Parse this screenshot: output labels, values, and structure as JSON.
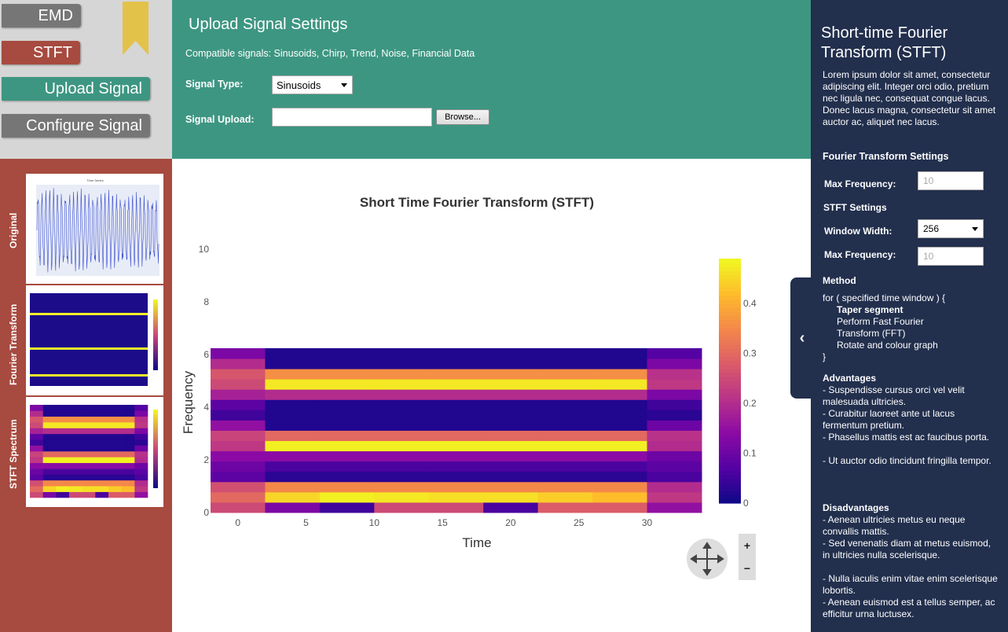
{
  "nav": {
    "emd_label": "EMD",
    "stft_label": "STFT",
    "upload_label": "Upload Signal",
    "configure_label": "Configure Signal"
  },
  "upload": {
    "title": "Upload Signal Settings",
    "compatible": "Compatible signals: Sinusoids, Chirp, Trend, Noise, Financial Data",
    "signal_type_label": "Signal Type:",
    "signal_type_value": "Sinusoids",
    "signal_upload_label": "Signal Upload:",
    "browse_label": "Browse..."
  },
  "thumbs": {
    "original_label": "Original",
    "fourier_label": "Fourier Transform",
    "stft_label": "STFT Spectrum",
    "original_title": "Time Series"
  },
  "chart_data": {
    "type": "heatmap",
    "title": "Short Time Fourier Transform (STFT)",
    "xlabel": "Time",
    "ylabel": "Frequency",
    "x_ticks": [
      0,
      5,
      10,
      15,
      20,
      25,
      30
    ],
    "y_ticks": [
      0,
      2,
      4,
      6,
      8,
      10
    ],
    "colorbar_ticks": [
      0,
      0.1,
      0.2,
      0.3,
      0.4
    ],
    "xlim": [
      -2,
      34
    ],
    "ylim": [
      0,
      10
    ],
    "zlim": [
      0,
      0.49
    ],
    "x_edges": [
      -2,
      2,
      6,
      10,
      14,
      18,
      22,
      26,
      30,
      34
    ],
    "y_edges": [
      0,
      0.39,
      0.78,
      1.17,
      1.56,
      1.95,
      2.34,
      2.73,
      3.12,
      3.51,
      3.9,
      4.29,
      4.68,
      5.07,
      5.46,
      5.85,
      6.24,
      6.63,
      7.02,
      7.41,
      7.8,
      8.19,
      8.58,
      8.97,
      9.36,
      10
    ],
    "z": [
      [
        0.25,
        0.12,
        0.05,
        0.25,
        0.25,
        0.06,
        0.28,
        0.28,
        0.15
      ],
      [
        0.3,
        0.45,
        0.48,
        0.47,
        0.46,
        0.46,
        0.44,
        0.42,
        0.22
      ],
      [
        0.26,
        0.35,
        0.35,
        0.35,
        0.35,
        0.35,
        0.35,
        0.35,
        0.2
      ],
      [
        0.08,
        0.03,
        0.03,
        0.03,
        0.03,
        0.03,
        0.03,
        0.03,
        0.06
      ],
      [
        0.1,
        0.06,
        0.06,
        0.06,
        0.06,
        0.06,
        0.06,
        0.06,
        0.08
      ],
      [
        0.14,
        0.14,
        0.14,
        0.14,
        0.14,
        0.14,
        0.14,
        0.14,
        0.1
      ],
      [
        0.22,
        0.48,
        0.48,
        0.48,
        0.48,
        0.48,
        0.48,
        0.48,
        0.2
      ],
      [
        0.24,
        0.3,
        0.3,
        0.3,
        0.3,
        0.3,
        0.3,
        0.3,
        0.21
      ],
      [
        0.15,
        0.02,
        0.02,
        0.02,
        0.02,
        0.02,
        0.02,
        0.02,
        0.1
      ],
      [
        0.05,
        0.02,
        0.02,
        0.02,
        0.02,
        0.02,
        0.02,
        0.02,
        0.03
      ],
      [
        0.08,
        0.02,
        0.02,
        0.02,
        0.02,
        0.02,
        0.02,
        0.02,
        0.05
      ],
      [
        0.18,
        0.2,
        0.2,
        0.2,
        0.2,
        0.2,
        0.2,
        0.2,
        0.12
      ],
      [
        0.25,
        0.47,
        0.47,
        0.47,
        0.47,
        0.47,
        0.47,
        0.47,
        0.22
      ],
      [
        0.27,
        0.36,
        0.36,
        0.36,
        0.36,
        0.36,
        0.36,
        0.36,
        0.21
      ],
      [
        0.2,
        0.02,
        0.02,
        0.02,
        0.02,
        0.02,
        0.02,
        0.02,
        0.12
      ],
      [
        0.12,
        0.02,
        0.02,
        0.02,
        0.02,
        0.02,
        0.02,
        0.02,
        0.07
      ]
    ]
  },
  "info": {
    "title": "Short-time Fourier Transform (STFT)",
    "intro": "Lorem ipsum dolor sit amet, consectetur adipiscing elit. Integer orci odio, pretium nec ligula nec, consequat congue lacus. Donec lacus magna, consectetur sit amet auctor ac, aliquet nec lacus.",
    "ft_settings": "Fourier Transform Settings",
    "max_freq_label": "Max Frequency:",
    "max_freq_placeholder": "10",
    "stft_settings": "STFT Settings",
    "window_width_label": "Window Width:",
    "window_width_value": "256",
    "max_freq2_label": "Max Frequency:",
    "max_freq2_placeholder": "10",
    "method_title": "Method",
    "method_lines": [
      "for ( specified time window ) {",
      "Taper segment",
      "Perform Fast Fourier",
      "Transform (FFT)",
      "Rotate and colour graph",
      "}"
    ],
    "advantages_title": "Advantages",
    "advantages": [
      "- Suspendisse cursus orci vel velit malesuada ultricies.",
      "- Curabitur laoreet ante ut lacus fermentum pretium.",
      "- Phasellus mattis est ac faucibus porta.",
      "- Ut auctor odio tincidunt fringilla tempor."
    ],
    "disadvantages_title": "Disadvantages",
    "disadvantages": [
      "- Aenean ultricies metus eu neque convallis mattis.",
      "- Sed venenatis diam at metus euismod, in ultricies nulla scelerisque.",
      "- Nulla iaculis enim vitae enim scelerisque lobortis.",
      "- Aenean euismod est a tellus semper, ac efficitur urna luctusex."
    ]
  },
  "colors": {
    "nav_gray": "#767676",
    "nav_red": "#a74a3f",
    "nav_green": "#3d9682",
    "upload_bg": "#3d9682",
    "thumbs_bg": "#a74a3f",
    "info_bg": "#222f4d",
    "bookmark": "#e3c24a"
  }
}
